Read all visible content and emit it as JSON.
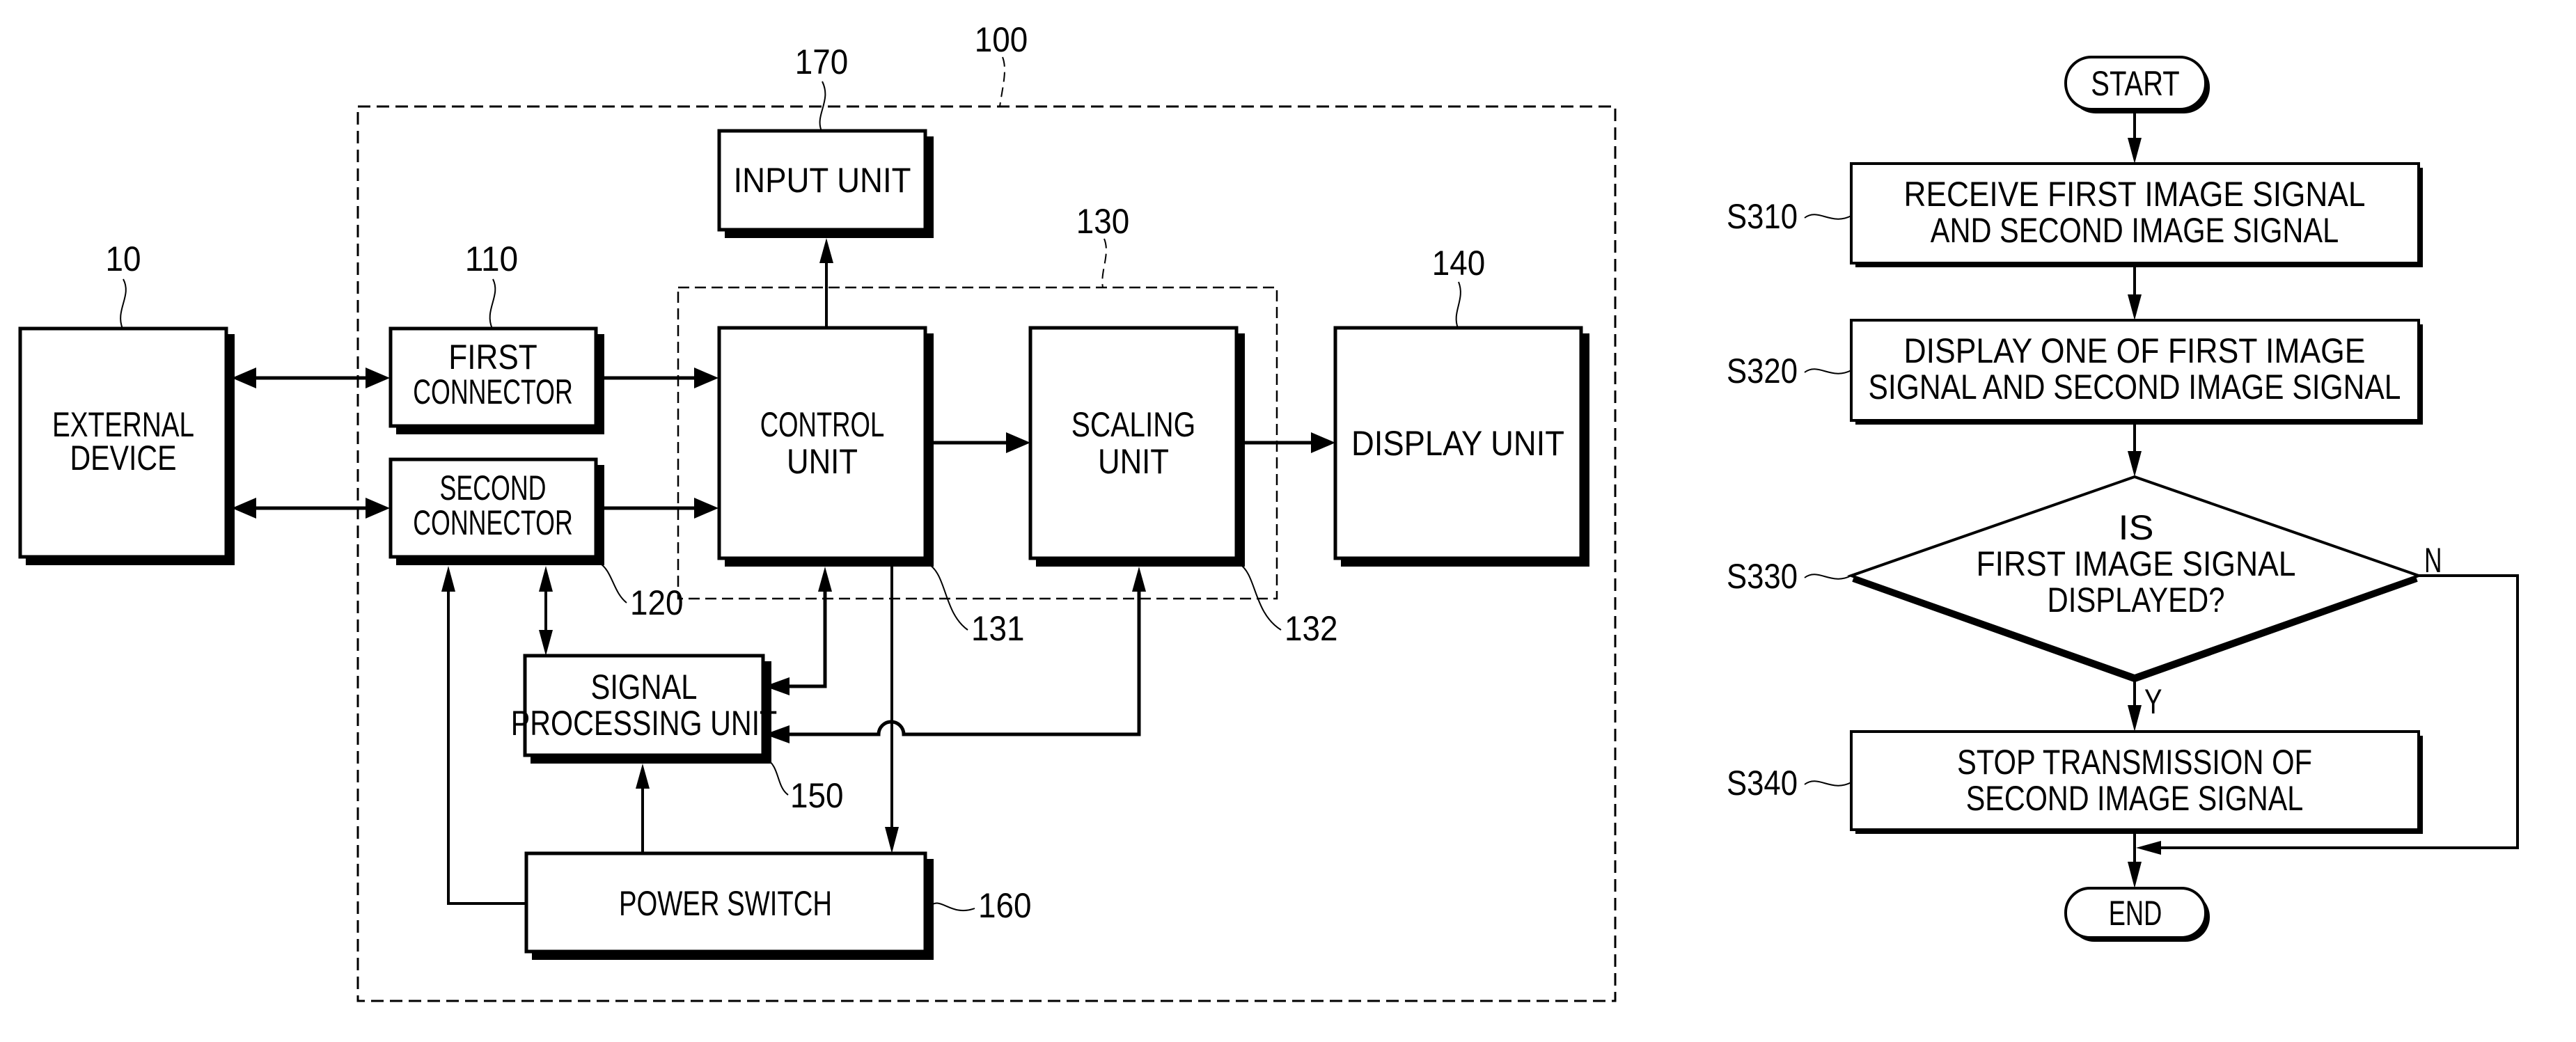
{
  "block_diagram": {
    "refs": {
      "device_100": "100",
      "external_device": "10",
      "first_connector": "110",
      "second_connector": "120",
      "processing_group": "130",
      "control_unit": "131",
      "scaling_unit": "132",
      "display_unit": "140",
      "signal_processing_unit": "150",
      "power_switch": "160",
      "input_unit": "170"
    },
    "blocks": {
      "external_device": [
        "EXTERNAL",
        "DEVICE"
      ],
      "first_connector": [
        "FIRST",
        "CONNECTOR"
      ],
      "second_connector": [
        "SECOND",
        "CONNECTOR"
      ],
      "input_unit": [
        "INPUT UNIT"
      ],
      "control_unit": [
        "CONTROL",
        "UNIT"
      ],
      "scaling_unit": [
        "SCALING",
        "UNIT"
      ],
      "display_unit": [
        "DISPLAY UNIT"
      ],
      "signal_processing_unit": [
        "SIGNAL",
        "PROCESSING UNIT"
      ],
      "power_switch": [
        "POWER SWITCH"
      ]
    }
  },
  "flowchart": {
    "start": "START",
    "end": "END",
    "steps": [
      {
        "id": "S310",
        "lines": [
          "RECEIVE FIRST IMAGE SIGNAL",
          "AND SECOND IMAGE SIGNAL"
        ]
      },
      {
        "id": "S320",
        "lines": [
          "DISPLAY ONE OF FIRST IMAGE",
          "SIGNAL AND SECOND IMAGE SIGNAL"
        ]
      },
      {
        "id": "S330",
        "lines": [
          "IS",
          "FIRST IMAGE SIGNAL",
          "DISPLAYED?"
        ]
      },
      {
        "id": "S340",
        "lines": [
          "STOP TRANSMISSION OF",
          "SECOND IMAGE SIGNAL"
        ]
      }
    ],
    "yes_label": "Y",
    "no_label": "N"
  }
}
